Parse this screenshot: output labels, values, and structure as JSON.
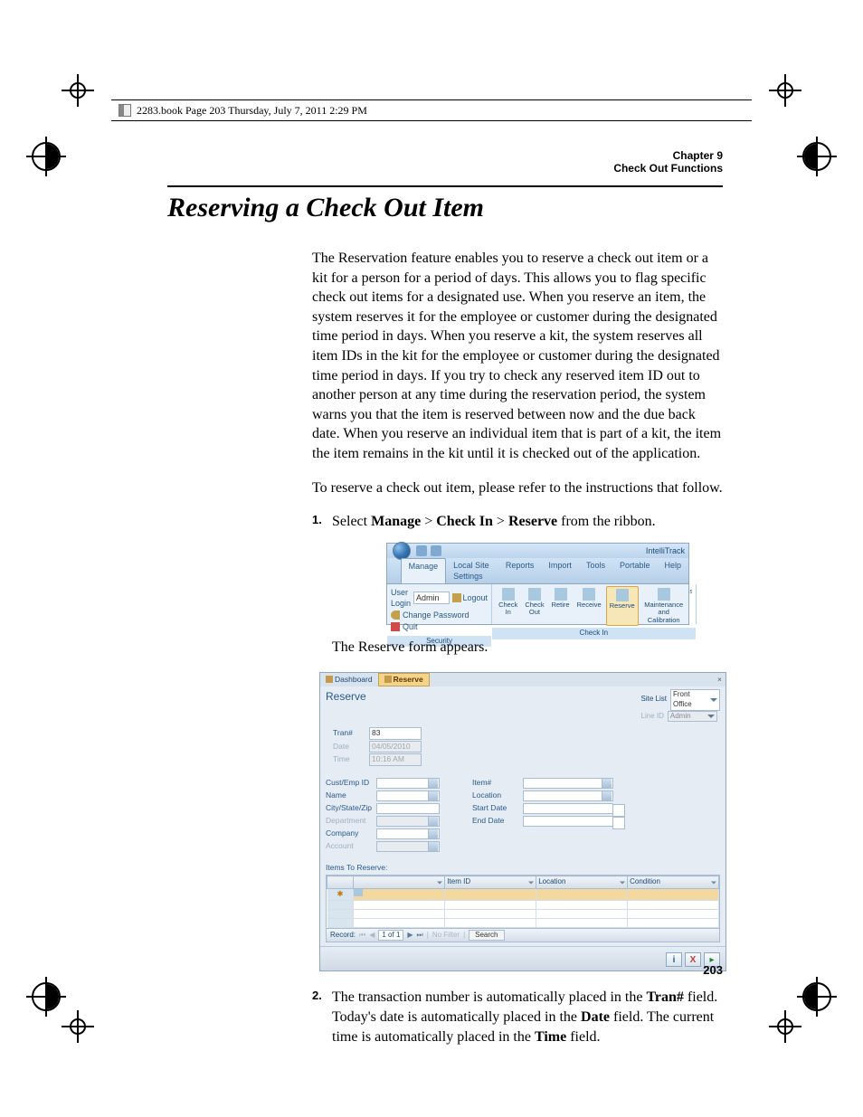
{
  "page_header": "2283.book  Page 203  Thursday, July 7, 2011  2:29 PM",
  "running": {
    "chapter": "Chapter 9",
    "title": "Check Out Functions"
  },
  "section_title": "Reserving a Check Out Item",
  "paragraphs": {
    "p1": "The Reservation feature enables you to reserve a check out item or a kit for a person for a period of days. This allows you to flag specific check out items for a designated use. When you reserve an item, the system reserves it for the employee or customer during the designated time period in days. When you reserve a kit, the system reserves all item IDs in the kit for the employee or customer during the designated time period in days. If you try to check any reserved item ID out to another person at any time during the reservation period, the system warns you that the item is reserved between now and the due back date. When you reserve an individual item that is part of a kit, the item the item remains in the kit until it is checked out of the application.",
    "p2": "To reserve a check out item, please refer to the instructions that follow.",
    "p3": "The Reserve form appears."
  },
  "steps": {
    "s1_pre": "Select ",
    "s1_b1": "Manage",
    "s1_gt1": " > ",
    "s1_b2": "Check In",
    "s1_gt2": " > ",
    "s1_b3": "Reserve",
    "s1_post": " from the ribbon.",
    "s2_a": "The transaction number is automatically placed in the ",
    "s2_b1": "Tran#",
    "s2_b": " field. Today's date is automatically placed in the ",
    "s2_b2": "Date",
    "s2_c": " field. The current time is automatically placed in the ",
    "s2_b3": "Time",
    "s2_d": " field."
  },
  "step_numbers": {
    "n1": "1.",
    "n2": "2."
  },
  "ribbon": {
    "app": "IntelliTrack",
    "tabs": [
      "Manage",
      "Local Site Settings",
      "Reports",
      "Import",
      "Tools",
      "Portable",
      "Help"
    ],
    "security": {
      "login_label": "User Login",
      "login_value": "Admin",
      "logout": "Logout",
      "change_pw": "Change Password",
      "quit": "Quit",
      "group": "Security"
    },
    "checkin": {
      "buttons": [
        "Check\nIn",
        "Check\nOut",
        "Retire",
        "Receive",
        "Reserve",
        "Maintenance\nand Calibration",
        "Is"
      ],
      "group": "Check In"
    }
  },
  "form": {
    "tabs": {
      "dashboard": "Dashboard",
      "reserve": "Reserve"
    },
    "title": "Reserve",
    "site_list_label": "Site List",
    "site_list_value": "Front Office",
    "line_id_label": "Line ID",
    "line_id_value": "Admin",
    "rows": {
      "tran_label": "Tran#",
      "tran_value": "83",
      "date_label": "Date",
      "date_value": "04/05/2010",
      "time_label": "Time",
      "time_value": "10:16 AM"
    },
    "left_fields": [
      "Cust/Emp ID",
      "Name",
      "City/State/Zip",
      "Department",
      "Company",
      "Account"
    ],
    "right_fields": [
      "Item#",
      "Location",
      "Start Date",
      "End Date"
    ],
    "grid_title": "Items To Reserve:",
    "grid_headers": [
      "",
      "",
      "Item ID",
      "Location",
      "Condition"
    ],
    "pager": {
      "label": "Record: ",
      "nav_first": "⏮",
      "nav_prev": "◀",
      "pos": "1 of 1",
      "nav_next": "▶",
      "nav_last": "⏭",
      "filter": "No Filter",
      "search": "Search"
    },
    "bottom_buttons": {
      "info": "i",
      "close": "X",
      "next": "▸"
    }
  },
  "page_number": "203"
}
